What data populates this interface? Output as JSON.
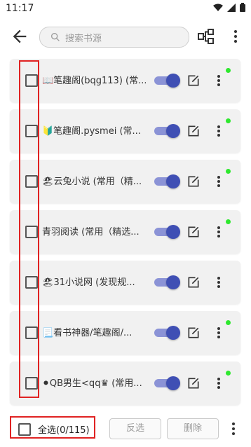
{
  "status_bar": {
    "time": "11:17"
  },
  "search": {
    "placeholder": "搜索书源"
  },
  "sources": [
    {
      "name": "📖笔趣阁(bqg113) (常...",
      "enabled": true,
      "has_dot": true
    },
    {
      "name": "🔰笔趣阁.pysmei (常...",
      "enabled": true,
      "has_dot": true
    },
    {
      "name": "🏖云兔小说 (常用（精...",
      "enabled": true,
      "has_dot": true
    },
    {
      "name": "青羽阅读 (常用（精选...",
      "enabled": true,
      "has_dot": true
    },
    {
      "name": "🏖31小说网 (发现规...",
      "enabled": true,
      "has_dot": false
    },
    {
      "name": "📃看书神器/笔趣阁/...",
      "enabled": true,
      "has_dot": true
    },
    {
      "name": "⚫QB男生<qq♛ (常用...",
      "enabled": true,
      "has_dot": true
    }
  ],
  "bottom_bar": {
    "select_all_label": "全选(0/115)",
    "invert_label": "反选",
    "delete_label": "删除"
  },
  "colors": {
    "accent": "#3f4fb4",
    "highlight": "#e02222",
    "dot": "#2ee82e"
  }
}
